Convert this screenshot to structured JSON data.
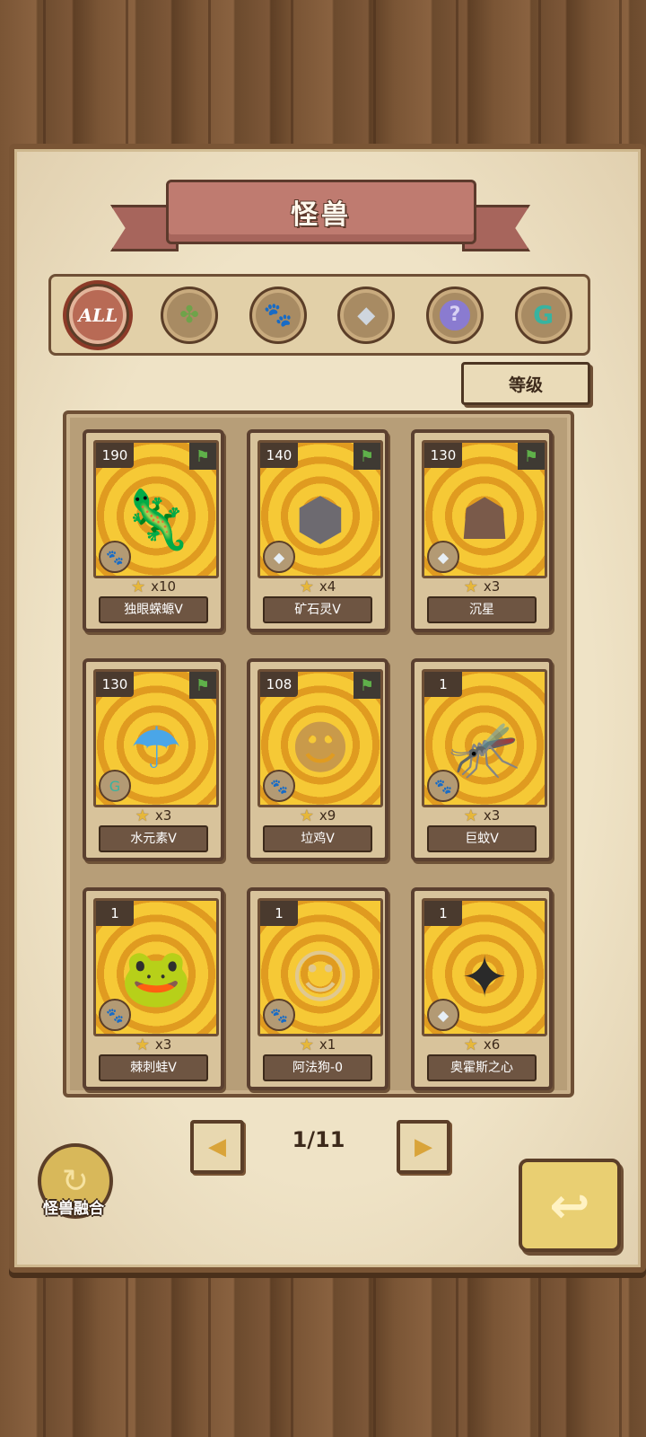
{
  "title": "怪兽",
  "filters": [
    {
      "label": "ALL",
      "icon": "all-icon",
      "active": true
    },
    {
      "label": "",
      "icon": "leaf-icon",
      "active": false
    },
    {
      "label": "",
      "icon": "paw-icon",
      "active": false
    },
    {
      "label": "",
      "icon": "crystal-icon",
      "active": false
    },
    {
      "label": "",
      "icon": "question-icon",
      "active": false
    },
    {
      "label": "",
      "icon": "g-rune-icon",
      "active": false
    }
  ],
  "sort_label": "等级",
  "cards": [
    {
      "level": "190",
      "count": "x10",
      "name": "独眼蝾螈V",
      "type_icon": "paw-icon",
      "flag": true,
      "creature_icon": "salamander-icon",
      "creature_color": "#e7a87c"
    },
    {
      "level": "140",
      "count": "x4",
      "name": "矿石灵V",
      "type_icon": "crystal-icon",
      "flag": true,
      "creature_icon": "rock-golem-icon",
      "creature_color": "#6d6a70"
    },
    {
      "level": "130",
      "count": "x3",
      "name": "沉星",
      "type_icon": "crystal-icon",
      "flag": true,
      "creature_icon": "stone-giant-icon",
      "creature_color": "#7a5a4a"
    },
    {
      "level": "130",
      "count": "x3",
      "name": "水元素V",
      "type_icon": "g-rune-icon",
      "flag": true,
      "creature_icon": "water-girl-icon",
      "creature_color": "#4aa6e8"
    },
    {
      "level": "108",
      "count": "x9",
      "name": "垃鸡V",
      "type_icon": "paw-icon",
      "flag": true,
      "creature_icon": "blond-boy-icon",
      "creature_color": "#c99a4a"
    },
    {
      "level": "1",
      "count": "x3",
      "name": "巨蚊V",
      "type_icon": "paw-icon",
      "flag": false,
      "creature_icon": "mosquito-icon",
      "creature_color": "#7a3a2a"
    },
    {
      "level": "1",
      "count": "x3",
      "name": "棘刺蛙V",
      "type_icon": "paw-icon",
      "flag": false,
      "creature_icon": "toad-icon",
      "creature_color": "#9a8a5a"
    },
    {
      "level": "1",
      "count": "x1",
      "name": "阿法狗-0",
      "type_icon": "paw-icon",
      "flag": false,
      "creature_icon": "bunny-girl-icon",
      "creature_color": "#e0c890"
    },
    {
      "level": "1",
      "count": "x6",
      "name": "奥霍斯之心",
      "type_icon": "crystal-icon",
      "flag": false,
      "creature_icon": "lava-spirit-icon",
      "creature_color": "#2a2a2a"
    }
  ],
  "pager": {
    "current": 1,
    "total": 11,
    "label": "1/11",
    "prev_icon": "prev-arrow-icon",
    "next_icon": "next-arrow-icon"
  },
  "fusion_label": "怪兽融合",
  "back_icon": "return-arrow-icon",
  "colors": {
    "accent": "#b86a55",
    "parchment": "#efe3c6",
    "wood": "#7a5535",
    "gold": "#f6c936"
  }
}
